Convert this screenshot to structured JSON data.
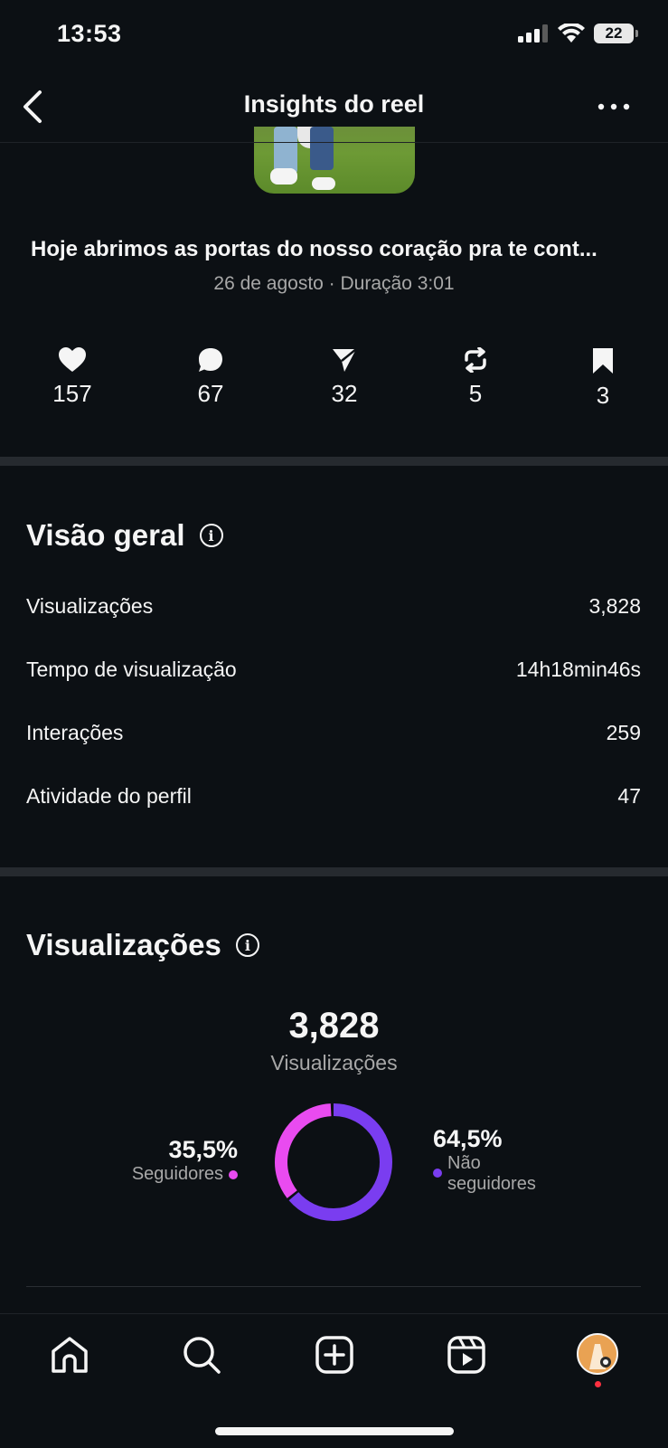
{
  "status_bar": {
    "time": "13:53",
    "battery": "22"
  },
  "header": {
    "title": "Insights do reel"
  },
  "reel": {
    "caption": "Hoje abrimos as portas do nosso coração pra te cont...",
    "meta": "26 de agosto · Duração 3:01"
  },
  "stats": [
    {
      "icon": "heart-icon",
      "value": "157"
    },
    {
      "icon": "comment-icon",
      "value": "67"
    },
    {
      "icon": "share-icon",
      "value": "32"
    },
    {
      "icon": "repost-icon",
      "value": "5"
    },
    {
      "icon": "bookmark-icon",
      "value": "3"
    }
  ],
  "overview": {
    "title": "Visão geral",
    "rows": [
      {
        "label": "Visualizações",
        "value": "3,828"
      },
      {
        "label": "Tempo de visualização",
        "value": "14h18min46s"
      },
      {
        "label": "Interações",
        "value": "259"
      },
      {
        "label": "Atividade do perfil",
        "value": "47"
      }
    ]
  },
  "views": {
    "title": "Visualizações",
    "total": "3,828",
    "total_label": "Visualizações",
    "followers": {
      "pct": "35,5%",
      "label": "Seguidores",
      "fraction": 0.355,
      "color": "#e94bf0"
    },
    "non_followers": {
      "pct": "64,5%",
      "label_line1": "Não",
      "label_line2": "seguidores",
      "fraction": 0.645,
      "color": "#7a3df0"
    }
  }
}
